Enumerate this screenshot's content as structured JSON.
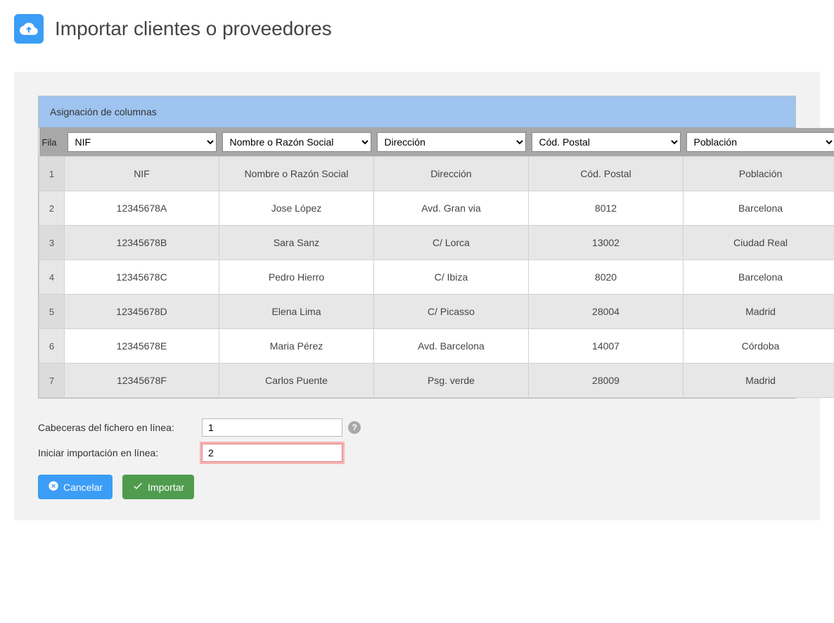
{
  "header": {
    "title": "Importar clientes o proveedores"
  },
  "panel": {
    "assignment_header": "Asignación de columnas",
    "row_label": "Fila",
    "columns": [
      {
        "selected": "NIF"
      },
      {
        "selected": "Nombre o Razón Social"
      },
      {
        "selected": "Dirección"
      },
      {
        "selected": "Cód. Postal"
      },
      {
        "selected": "Población"
      }
    ],
    "rows": [
      {
        "idx": "1",
        "c0": "NIF",
        "c1": "Nombre o Razón Social",
        "c2": "Dirección",
        "c3": "Cód. Postal",
        "c4": "Población"
      },
      {
        "idx": "2",
        "c0": "12345678A",
        "c1": "Jose López",
        "c2": "Avd. Gran via",
        "c3": "8012",
        "c4": "Barcelona"
      },
      {
        "idx": "3",
        "c0": "12345678B",
        "c1": "Sara Sanz",
        "c2": "C/ Lorca",
        "c3": "13002",
        "c4": "Ciudad Real"
      },
      {
        "idx": "4",
        "c0": "12345678C",
        "c1": "Pedro Hierro",
        "c2": "C/ Ibiza",
        "c3": "8020",
        "c4": "Barcelona"
      },
      {
        "idx": "5",
        "c0": "12345678D",
        "c1": "Elena Lima",
        "c2": "C/ Picasso",
        "c3": "28004",
        "c4": "Madrid"
      },
      {
        "idx": "6",
        "c0": "12345678E",
        "c1": "Maria Pérez",
        "c2": "Avd. Barcelona",
        "c3": "14007",
        "c4": "Córdoba"
      },
      {
        "idx": "7",
        "c0": "12345678F",
        "c1": "Carlos Puente",
        "c2": "Psg. verde",
        "c3": "28009",
        "c4": "Madrid"
      }
    ]
  },
  "form": {
    "header_line_label": "Cabeceras del fichero en línea:",
    "header_line_value": "1",
    "start_line_label": "Iniciar importación en línea:",
    "start_line_value": "2"
  },
  "buttons": {
    "cancel": "Cancelar",
    "import": "Importar"
  }
}
